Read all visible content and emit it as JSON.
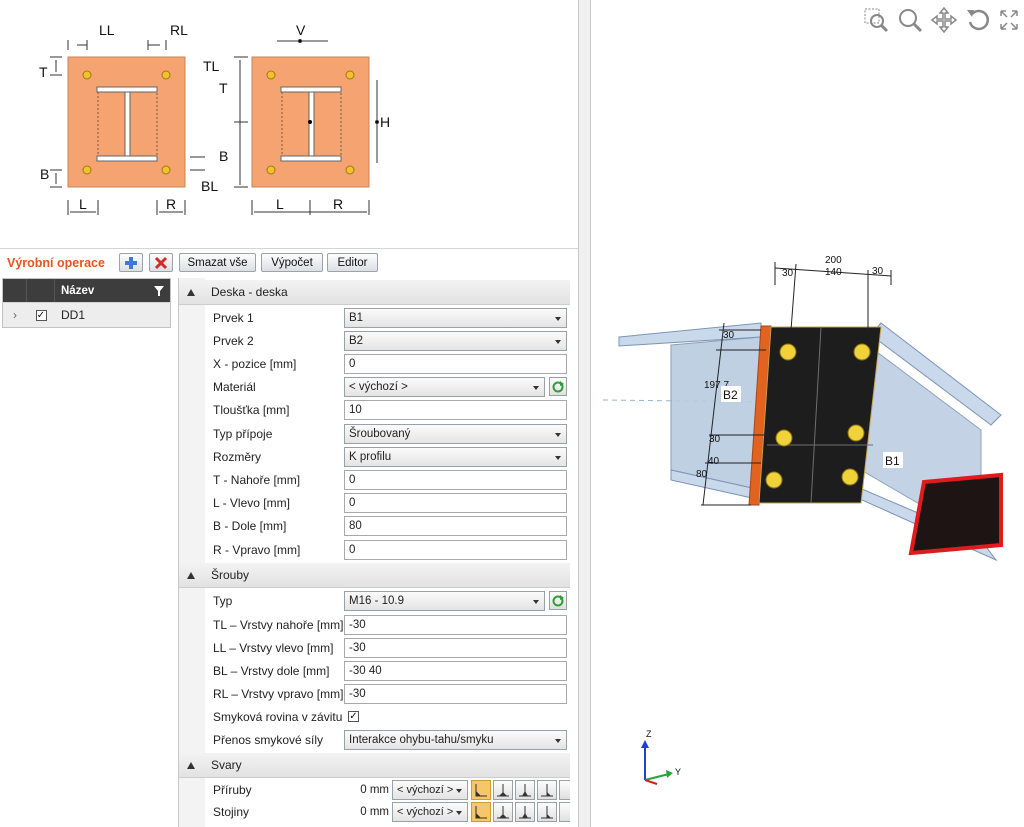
{
  "diagram": {
    "left": {
      "LL": "LL",
      "RL": "RL",
      "T": "T",
      "B": "B",
      "L": "L",
      "R": "R",
      "BL": "BL",
      "TL": "TL"
    },
    "right": {
      "V": "V",
      "T": "T",
      "B": "B",
      "L": "L",
      "R": "R",
      "H": "H"
    }
  },
  "toolbar": {
    "title": "Výrobní operace",
    "clear_all": "Smazat vše",
    "compute": "Výpočet",
    "editor": "Editor"
  },
  "list": {
    "header": "Název",
    "rows": [
      {
        "name": "DD1",
        "checked": true
      }
    ]
  },
  "groups": {
    "plate": "Deska - deska",
    "bolts": "Šrouby",
    "welds": "Svary"
  },
  "plate_props": [
    {
      "label": "Prvek 1",
      "value": "B1",
      "kind": "dd"
    },
    {
      "label": "Prvek 2",
      "value": "B2",
      "kind": "dd"
    },
    {
      "label": "X - pozice [mm]",
      "value": "0",
      "kind": "text"
    },
    {
      "label": "Materiál",
      "value": "< výchozí >",
      "kind": "ddr"
    },
    {
      "label": "Tloušťka [mm]",
      "value": "10",
      "kind": "text"
    },
    {
      "label": "Typ přípoje",
      "value": "Šroubovaný",
      "kind": "dd"
    },
    {
      "label": "Rozměry",
      "value": "K profilu",
      "kind": "dd"
    },
    {
      "label": "T - Nahoře [mm]",
      "value": "0",
      "kind": "text"
    },
    {
      "label": "L - Vlevo [mm]",
      "value": "0",
      "kind": "text"
    },
    {
      "label": "B - Dole [mm]",
      "value": "80",
      "kind": "text"
    },
    {
      "label": "R - Vpravo [mm]",
      "value": "0",
      "kind": "text"
    }
  ],
  "bolt_props": [
    {
      "label": "Typ",
      "value": "M16 - 10.9",
      "kind": "ddr"
    },
    {
      "label": "TL – Vrstvy nahoře [mm]",
      "value": "-30",
      "kind": "text"
    },
    {
      "label": "LL – Vrstvy vlevo [mm]",
      "value": "-30",
      "kind": "text"
    },
    {
      "label": "BL – Vrstvy dole [mm]",
      "value": "-30 40",
      "kind": "text"
    },
    {
      "label": "RL – Vrstvy vpravo [mm]",
      "value": "-30",
      "kind": "text"
    },
    {
      "label": "Smyková rovina v závitu",
      "value": "",
      "kind": "check"
    },
    {
      "label": "Přenos smykové síly",
      "value": "Interakce ohybu-tahu/smyku",
      "kind": "dd"
    }
  ],
  "weld_props": [
    {
      "label": "Příruby",
      "size": "0 mm",
      "material": "< výchozí >"
    },
    {
      "label": "Stojiny",
      "size": "0 mm",
      "material": "< výchozí >"
    }
  ],
  "viewport": {
    "dims": {
      "d200": "200",
      "d140": "140",
      "d30a": "30",
      "d30b": "30",
      "v30a": "30",
      "v197": "197.7",
      "v30b": "30",
      "v40": "40",
      "v80": "80"
    },
    "labels": {
      "b1": "B1",
      "b2": "B2"
    },
    "axes": {
      "z": "Z",
      "y": "Y"
    }
  }
}
